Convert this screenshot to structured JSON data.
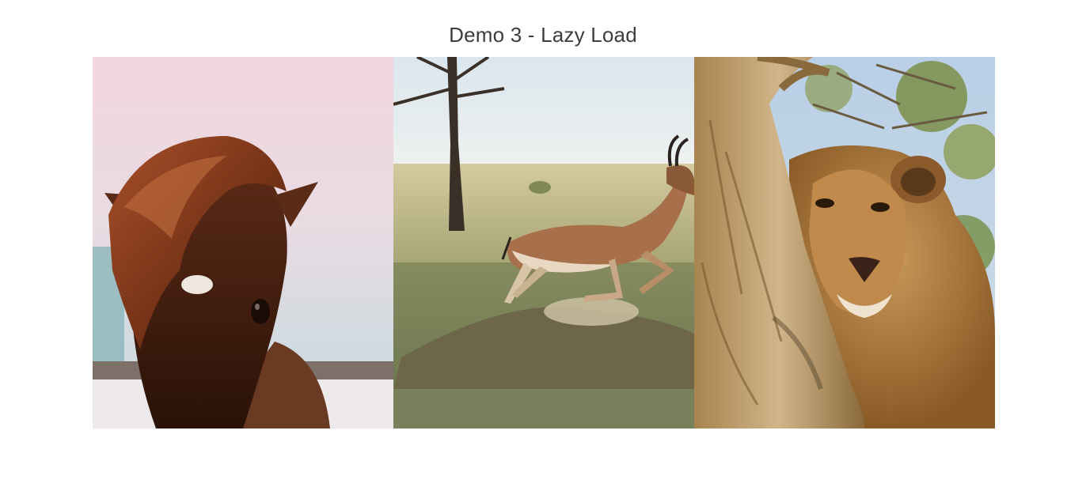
{
  "page": {
    "title": "Demo 3 - Lazy Load"
  },
  "gallery": {
    "images": [
      {
        "subject": "horse"
      },
      {
        "subject": "gazelle"
      },
      {
        "subject": "lioness"
      }
    ]
  },
  "colors": {
    "title": "#3d3d3d",
    "background": "#ffffff"
  }
}
